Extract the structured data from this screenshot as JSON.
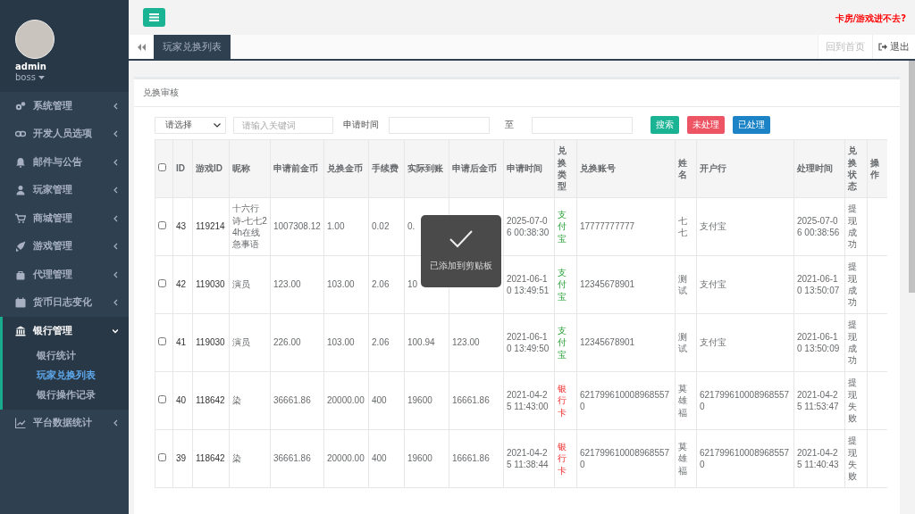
{
  "sidebar": {
    "user": {
      "name": "admin",
      "role": "boss"
    },
    "items": [
      {
        "label": "系统管理",
        "expanded": false,
        "selected": false
      },
      {
        "label": "开发人员选项",
        "expanded": false,
        "selected": false
      },
      {
        "label": "邮件与公告",
        "expanded": false,
        "selected": false
      },
      {
        "label": "玩家管理",
        "expanded": false,
        "selected": false
      },
      {
        "label": "商城管理",
        "expanded": false,
        "selected": false
      },
      {
        "label": "游戏管理",
        "expanded": false,
        "selected": false
      },
      {
        "label": "代理管理",
        "expanded": false,
        "selected": false
      },
      {
        "label": "货币日志变化",
        "expanded": false,
        "selected": false
      },
      {
        "label": "银行管理",
        "expanded": true,
        "selected": true,
        "children": [
          {
            "label": "银行统计",
            "selected": false
          },
          {
            "label": "玩家兑换列表",
            "selected": true
          },
          {
            "label": "银行操作记录",
            "selected": false
          }
        ]
      },
      {
        "label": "平台数据统计",
        "expanded": false,
        "selected": false
      }
    ]
  },
  "header": {
    "notice": "卡房/游戏进不去?"
  },
  "tabs": [
    {
      "label": "玩家兑换列表",
      "selected": true
    }
  ],
  "tab_actions": {
    "home": "回到首页",
    "logout": "退出"
  },
  "card": {
    "title": "兑换审核",
    "filters": {
      "select": "请选择",
      "keyword_placeholder": "请输入关键词",
      "time_label": "申请时间",
      "to_label": "至"
    },
    "buttons": [
      {
        "label": "搜索",
        "kind": "primary"
      },
      {
        "label": "未处理",
        "kind": "danger"
      },
      {
        "label": "已处理",
        "kind": "success"
      }
    ]
  },
  "table": {
    "header_checked": false,
    "columns": [
      "ID",
      "游戏ID",
      "昵称",
      "申请前金币",
      "兑换金币",
      "手续费",
      "实际到账",
      "申请后金币",
      "申请时间",
      "兑换类型",
      "兑换账号",
      "姓名",
      "开户行",
      "处理时间",
      "兑换状态",
      "操作"
    ],
    "rows": [
      {
        "checked": false,
        "cells": [
          "43",
          "119214",
          "十六行诗-七七24h在线急事语",
          "1007308.12",
          "1.00",
          "0.02",
          "0.",
          "",
          "2025-07-06 00:38:30",
          "支付宝",
          "17777777777",
          "七七",
          "支付宝",
          "2025-07-06 00:38:56",
          "提现成功",
          ""
        ],
        "kind": "alipay"
      },
      {
        "checked": false,
        "cells": [
          "42",
          "119030",
          "演员",
          "123.00",
          "103.00",
          "2.06",
          "10",
          "",
          "2021-06-10 13:49:51",
          "支付宝",
          "12345678901",
          "测试",
          "支付宝",
          "2021-06-10 13:50:07",
          "提现成功",
          ""
        ],
        "kind": "alipay"
      },
      {
        "checked": false,
        "cells": [
          "41",
          "119030",
          "演员",
          "226.00",
          "103.00",
          "2.06",
          "100.94",
          "123.00",
          "2021-06-10 13:49:50",
          "支付宝",
          "12345678901",
          "测试",
          "支付宝",
          "2021-06-10 13:50:09",
          "提现成功",
          ""
        ],
        "kind": "alipay"
      },
      {
        "checked": false,
        "cells": [
          "40",
          "118642",
          "染",
          "36661.86",
          "20000.00",
          "400",
          "19600",
          "16661.86",
          "2021-04-25 11:43:00",
          "银行卡",
          "6217996100089685570",
          "莫雄福",
          "6217996100089685570",
          "2021-04-25 11:53:47",
          "提现失败",
          ""
        ],
        "kind": "bank"
      },
      {
        "checked": false,
        "cells": [
          "39",
          "118642",
          "染",
          "36661.86",
          "20000.00",
          "400",
          "19600",
          "16661.86",
          "2021-04-25 11:38:44",
          "银行卡",
          "6217996100089685570",
          "莫雄福",
          "6217996100089685570",
          "2021-04-25 11:40:43",
          "提现失败",
          ""
        ],
        "kind": "bank"
      }
    ]
  },
  "toast": {
    "message": "已添加到剪贴板"
  }
}
